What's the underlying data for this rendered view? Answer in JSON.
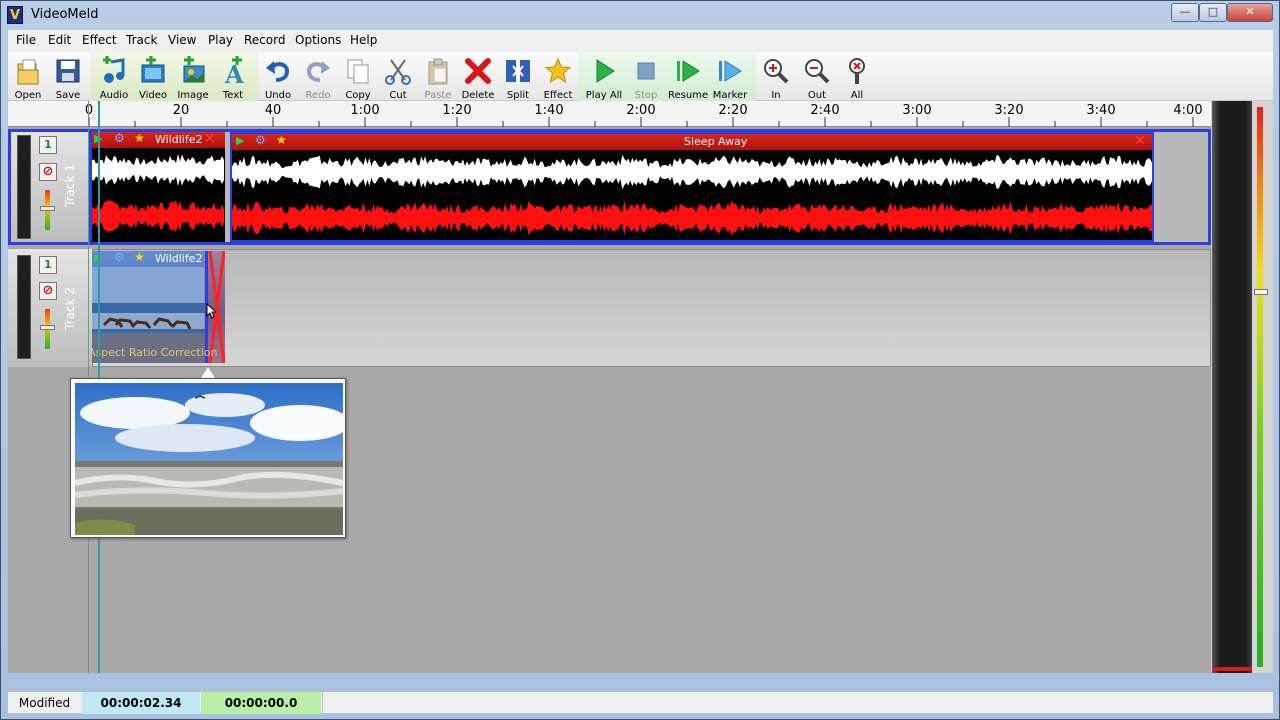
{
  "window": {
    "title": "VideoMeld",
    "app_icon": "V",
    "controls": {
      "minimize": "—",
      "maximize": "□",
      "close": "✕"
    }
  },
  "menu": [
    "File",
    "Edit",
    "Effect",
    "Track",
    "View",
    "Play",
    "Record",
    "Options",
    "Help"
  ],
  "toolbar": [
    {
      "label": "Open",
      "icon": "folder-icon"
    },
    {
      "label": "Save",
      "icon": "floppy-disk-icon"
    },
    {
      "label": "Audio",
      "icon": "add-audio-icon"
    },
    {
      "label": "Video",
      "icon": "add-video-icon"
    },
    {
      "label": "Image",
      "icon": "add-image-icon"
    },
    {
      "label": "Text",
      "icon": "add-text-icon"
    },
    {
      "label": "Undo",
      "icon": "undo-icon"
    },
    {
      "label": "Redo",
      "icon": "redo-icon"
    },
    {
      "label": "Copy",
      "icon": "copy-icon"
    },
    {
      "label": "Cut",
      "icon": "scissors-icon"
    },
    {
      "label": "Paste",
      "icon": "paste-icon"
    },
    {
      "label": "Delete",
      "icon": "delete-x-icon"
    },
    {
      "label": "Split",
      "icon": "split-icon"
    },
    {
      "label": "Effect",
      "icon": "star-icon"
    },
    {
      "label": "Play All",
      "icon": "play-icon"
    },
    {
      "label": "Stop",
      "icon": "stop-icon"
    },
    {
      "label": "Resume",
      "icon": "resume-icon"
    },
    {
      "label": "Marker",
      "icon": "marker-icon"
    },
    {
      "label": "In",
      "icon": "zoom-in-icon"
    },
    {
      "label": "Out",
      "icon": "zoom-out-icon"
    },
    {
      "label": "All",
      "icon": "zoom-all-icon"
    }
  ],
  "ruler": {
    "labels": [
      "0",
      "20",
      "40",
      "1:00",
      "1:20",
      "1:40",
      "2:00",
      "2:20",
      "2:40",
      "3:00",
      "3:20",
      "3:40",
      "4:00"
    ]
  },
  "tracks": [
    {
      "label": "Track 1",
      "solo": "1",
      "mute": "⊘",
      "clips": [
        {
          "title": "Wildlife2",
          "kind": "audio"
        },
        {
          "title": "Sleep Away",
          "kind": "audio"
        }
      ]
    },
    {
      "label": "Track 2",
      "solo": "1",
      "mute": "⊘",
      "clips": [
        {
          "title": "Wildlife2",
          "kind": "video",
          "effect_label": "Aspect Ratio Correction"
        }
      ]
    }
  ],
  "status": {
    "state": "Modified",
    "position": "00:00:02.34",
    "selection": "00:00:00.0"
  },
  "colors": {
    "accent_selection": "#2a3fe0",
    "wave_left": "#ffffff",
    "wave_right": "#ff1010",
    "position_bg": "#bde8f4",
    "selection_bg": "#b8f0a6"
  }
}
